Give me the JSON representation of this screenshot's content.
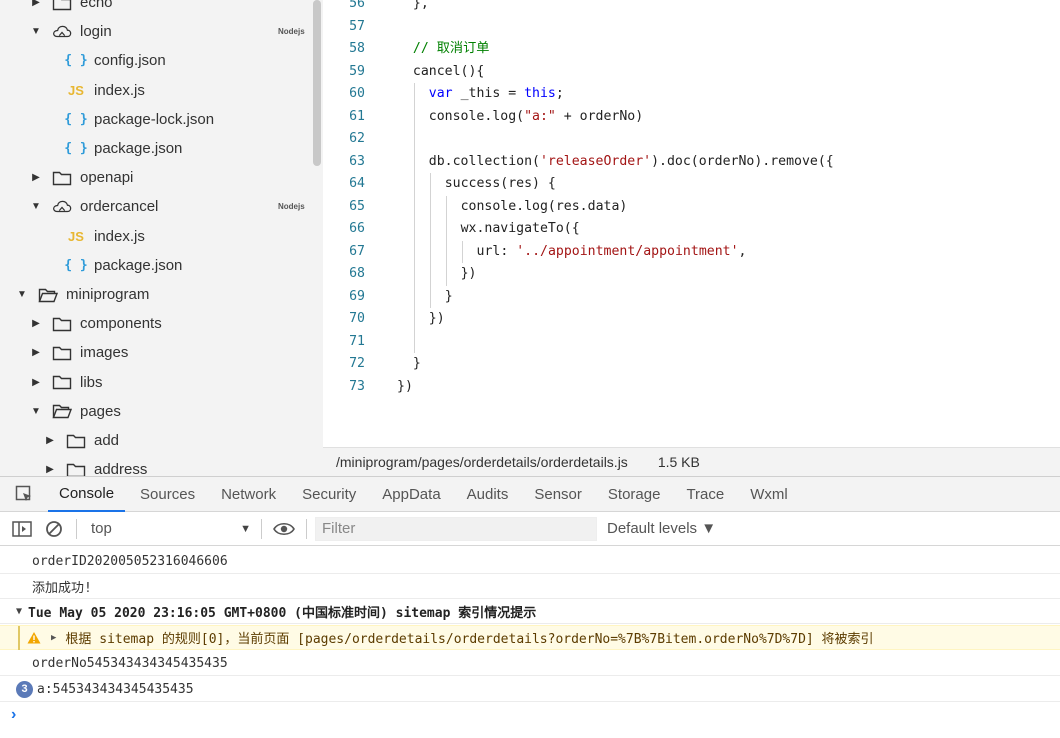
{
  "file_tree": {
    "items": [
      {
        "label": "echo",
        "kind": "folder",
        "depth": 1,
        "arrow": "right"
      },
      {
        "label": "login",
        "kind": "cloud",
        "depth": 1,
        "arrow": "down",
        "badge": "Nodejs"
      },
      {
        "label": "config.json",
        "kind": "json",
        "depth": 2
      },
      {
        "label": "index.js",
        "kind": "js",
        "depth": 2
      },
      {
        "label": "package-lock.json",
        "kind": "json",
        "depth": 2
      },
      {
        "label": "package.json",
        "kind": "json",
        "depth": 2
      },
      {
        "label": "openapi",
        "kind": "folder",
        "depth": 1,
        "arrow": "right"
      },
      {
        "label": "ordercancel",
        "kind": "cloud",
        "depth": 1,
        "arrow": "down",
        "badge": "Nodejs"
      },
      {
        "label": "index.js",
        "kind": "js",
        "depth": 2
      },
      {
        "label": "package.json",
        "kind": "json",
        "depth": 2
      },
      {
        "label": "miniprogram",
        "kind": "folder-open",
        "depth": 0,
        "arrow": "down"
      },
      {
        "label": "components",
        "kind": "folder",
        "depth": 1,
        "arrow": "right"
      },
      {
        "label": "images",
        "kind": "folder",
        "depth": 1,
        "arrow": "right"
      },
      {
        "label": "libs",
        "kind": "folder",
        "depth": 1,
        "arrow": "right"
      },
      {
        "label": "pages",
        "kind": "folder-open",
        "depth": 1,
        "arrow": "down"
      },
      {
        "label": "add",
        "kind": "folder",
        "depth": 2,
        "arrow": "right"
      },
      {
        "label": "address",
        "kind": "folder",
        "depth": 2,
        "arrow": "right"
      }
    ]
  },
  "editor": {
    "lines": [
      {
        "n": "56",
        "indent": 1,
        "tokens": [
          {
            "t": "},",
            "c": ""
          }
        ]
      },
      {
        "n": "57",
        "indent": 0,
        "tokens": []
      },
      {
        "n": "58",
        "indent": 1,
        "tokens": [
          {
            "t": "// 取消订单",
            "c": "cm"
          }
        ]
      },
      {
        "n": "59",
        "indent": 1,
        "tokens": [
          {
            "t": "cancel(){",
            "c": ""
          }
        ]
      },
      {
        "n": "60",
        "indent": 2,
        "tokens": [
          {
            "t": "var",
            "c": "kw"
          },
          {
            "t": " _this = ",
            "c": ""
          },
          {
            "t": "this",
            "c": "kw"
          },
          {
            "t": ";",
            "c": ""
          }
        ]
      },
      {
        "n": "61",
        "indent": 2,
        "tokens": [
          {
            "t": "console.log(",
            "c": ""
          },
          {
            "t": "\"a:\"",
            "c": "str"
          },
          {
            "t": " + orderNo)",
            "c": ""
          }
        ]
      },
      {
        "n": "62",
        "indent": 2,
        "tokens": []
      },
      {
        "n": "63",
        "indent": 2,
        "tokens": [
          {
            "t": "db.collection(",
            "c": ""
          },
          {
            "t": "'releaseOrder'",
            "c": "str"
          },
          {
            "t": ").doc(orderNo).remove({",
            "c": ""
          }
        ]
      },
      {
        "n": "64",
        "indent": 3,
        "tokens": [
          {
            "t": "success(res) {",
            "c": ""
          }
        ]
      },
      {
        "n": "65",
        "indent": 4,
        "tokens": [
          {
            "t": "console.log(res.data)",
            "c": ""
          }
        ]
      },
      {
        "n": "66",
        "indent": 4,
        "tokens": [
          {
            "t": "wx.navigateTo({",
            "c": ""
          }
        ]
      },
      {
        "n": "67",
        "indent": 5,
        "tokens": [
          {
            "t": "url: ",
            "c": ""
          },
          {
            "t": "'../appointment/appointment'",
            "c": "str"
          },
          {
            "t": ",",
            "c": ""
          }
        ]
      },
      {
        "n": "68",
        "indent": 4,
        "tokens": [
          {
            "t": "})",
            "c": ""
          }
        ]
      },
      {
        "n": "69",
        "indent": 3,
        "tokens": [
          {
            "t": "}",
            "c": ""
          }
        ]
      },
      {
        "n": "70",
        "indent": 2,
        "tokens": [
          {
            "t": "})",
            "c": ""
          }
        ]
      },
      {
        "n": "71",
        "indent": 2,
        "tokens": []
      },
      {
        "n": "72",
        "indent": 1,
        "tokens": [
          {
            "t": "}",
            "c": ""
          }
        ]
      },
      {
        "n": "73",
        "indent": 0,
        "tokens": [
          {
            "t": "})",
            "c": ""
          }
        ]
      }
    ]
  },
  "status_bar": {
    "path": "/miniprogram/pages/orderdetails/orderdetails.js",
    "size": "1.5 KB"
  },
  "devtools": {
    "tabs": [
      "Console",
      "Sources",
      "Network",
      "Security",
      "AppData",
      "Audits",
      "Sensor",
      "Storage",
      "Trace",
      "Wxml"
    ],
    "active_tab": "Console",
    "context": "top",
    "filter_placeholder": "Filter",
    "levels": "Default levels ▼"
  },
  "console": {
    "messages": [
      {
        "type": "log",
        "text": "orderID202005052316046606"
      },
      {
        "type": "log",
        "text": "添加成功!"
      },
      {
        "type": "group",
        "text": "Tue May 05 2020 23:16:05 GMT+0800 (中国标准时间) sitemap 索引情况提示"
      },
      {
        "type": "warn",
        "text": "根据 sitemap 的规则[0]，当前页面 [pages/orderdetails/orderdetails?orderNo=%7B%7Bitem.orderNo%7D%7D] 将被索引"
      },
      {
        "type": "log",
        "text": "orderNo545343434345435435"
      },
      {
        "type": "count",
        "count": "3",
        "text": "a:545343434345435435"
      }
    ]
  },
  "colors": {
    "keyword": "#0000ff",
    "string": "#a31515",
    "comment": "#008000",
    "line_number": "#237893",
    "accent": "#1a73e8"
  }
}
